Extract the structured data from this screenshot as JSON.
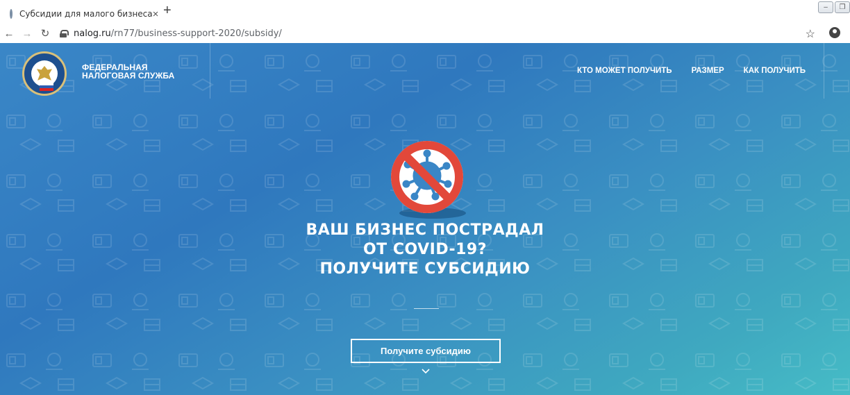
{
  "browser": {
    "tab_title": "Субсидии для малого бизнеса",
    "tab_close": "×",
    "new_tab": "+",
    "url_host": "nalog.ru",
    "url_path": "/rn77/business-support-2020/subsidy/",
    "star": "☆"
  },
  "site": {
    "brand_line1": "ФЕДЕРАЛЬНАЯ",
    "brand_line2": "НАЛОГОВАЯ СЛУЖБА",
    "nav": [
      "КТО МОЖЕТ ПОЛУЧИТЬ",
      "РАЗМЕР",
      "КАК ПОЛУЧИТЬ"
    ]
  },
  "hero": {
    "line1": "ВАШ БИЗНЕС ПОСТРАДАЛ",
    "line2": "ОТ COVID-19?",
    "line3": "ПОЛУЧИТЕ СУБСИДИЮ",
    "cta": "Получите субсидию"
  },
  "colors": {
    "accent_red": "#e2483a",
    "hero_blue": "#2f78be",
    "hero_teal": "#46bcc6"
  }
}
